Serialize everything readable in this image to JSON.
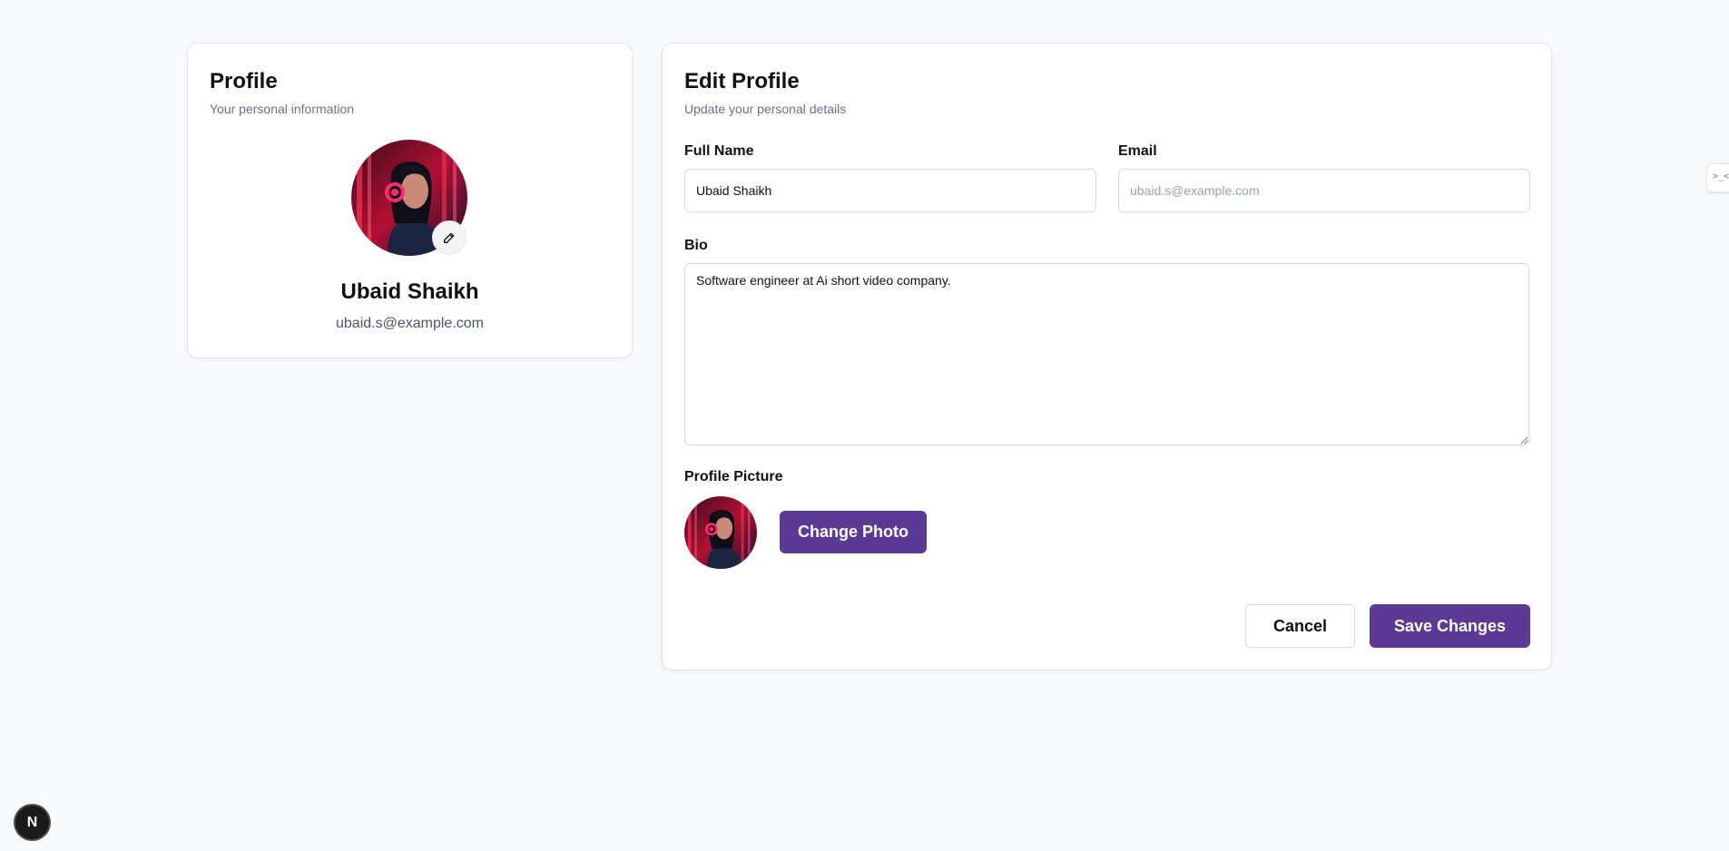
{
  "profile_card": {
    "title": "Profile",
    "subtitle": "Your personal information",
    "name": "Ubaid Shaikh",
    "email": "ubaid.s@example.com"
  },
  "edit_card": {
    "title": "Edit Profile",
    "subtitle": "Update your personal details",
    "full_name_label": "Full Name",
    "full_name_value": "Ubaid Shaikh",
    "email_label": "Email",
    "email_placeholder": "ubaid.s@example.com",
    "bio_label": "Bio",
    "bio_value": "Software engineer at Ai short video company.",
    "picture_label": "Profile Picture",
    "change_photo_label": "Change Photo",
    "cancel_label": "Cancel",
    "save_label": "Save Changes"
  },
  "next_badge": {
    "letter": "N"
  },
  "edge_tab": {
    "text": ">_<"
  },
  "colors": {
    "accent": "#5b3a96",
    "background": "#f8f9fb",
    "avatar_glow": "#ff2d6f"
  },
  "icons": {
    "edit_avatar": "pencil-icon"
  }
}
